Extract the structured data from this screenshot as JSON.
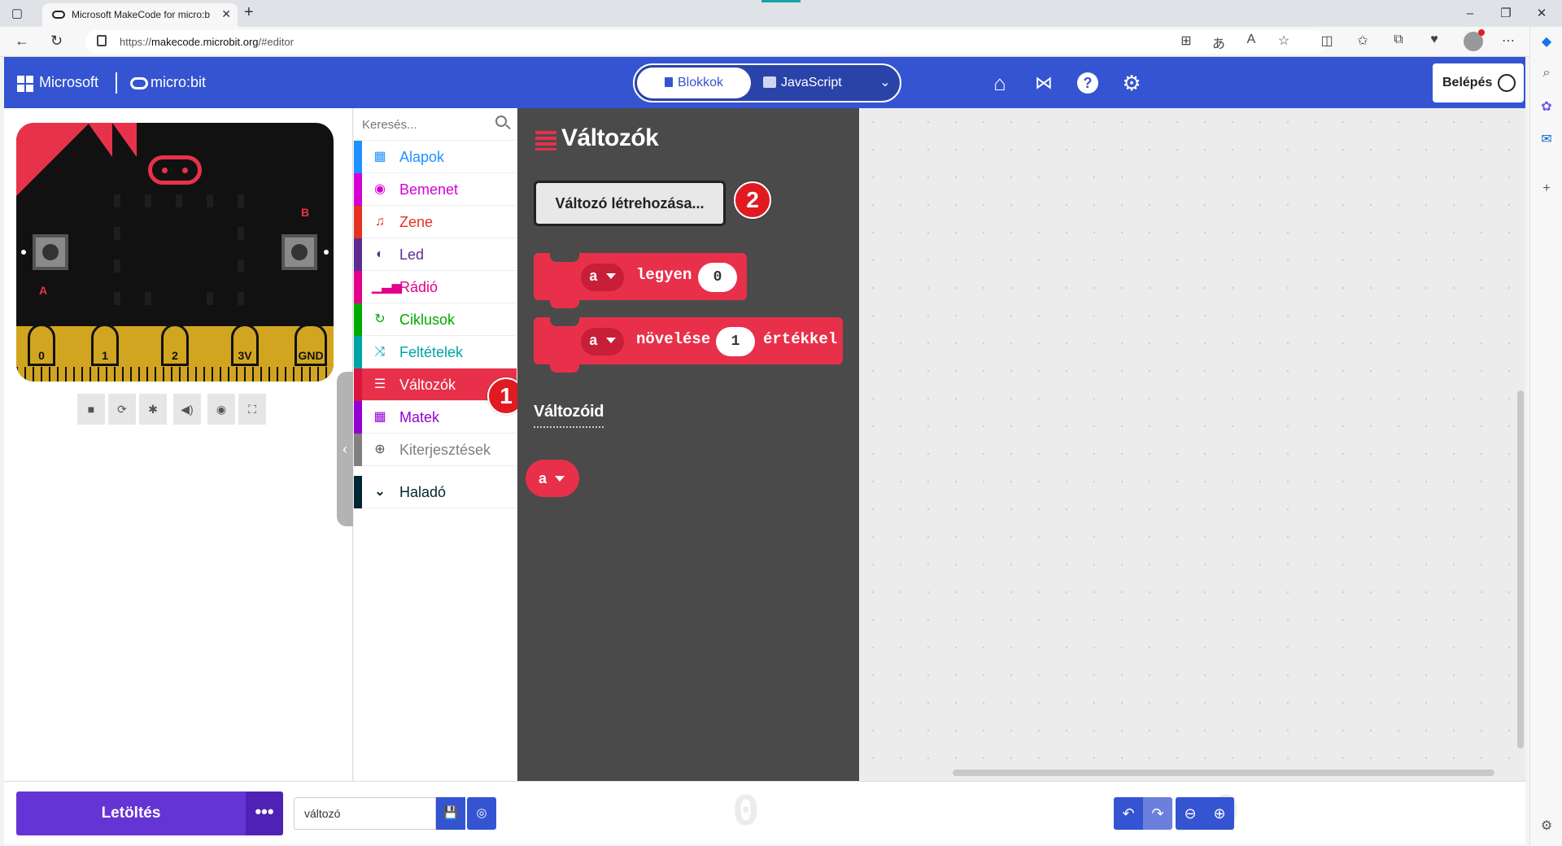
{
  "browser": {
    "tab_title": "Microsoft MakeCode for micro:bit",
    "url_prefix": "https://",
    "url_domain": "makecode.microbit.org",
    "url_path": "/#editor"
  },
  "header": {
    "brand": "Microsoft",
    "product": "micro:bit",
    "mode_blocks": "Blokkok",
    "mode_js": "JavaScript",
    "login_label": "Belépés"
  },
  "toolbox": {
    "search_placeholder": "Keresés...",
    "categories": [
      {
        "label": "Alapok",
        "color": "#1e90ff",
        "icon": "grid-icon"
      },
      {
        "label": "Bemenet",
        "color": "#d400d4",
        "icon": "input-icon"
      },
      {
        "label": "Zene",
        "color": "#e63022",
        "icon": "headphones-icon"
      },
      {
        "label": "Led",
        "color": "#5c2d91",
        "icon": "toggle-icon"
      },
      {
        "label": "Rádió",
        "color": "#e3008c",
        "icon": "signal-icon"
      },
      {
        "label": "Ciklusok",
        "color": "#00aa00",
        "icon": "loop-icon"
      },
      {
        "label": "Feltételek",
        "color": "#00a4a6",
        "icon": "shuffle-icon"
      },
      {
        "label": "Változók",
        "color": "#dc143c",
        "icon": "list-icon"
      },
      {
        "label": "Matek",
        "color": "#9400d3",
        "icon": "calculator-icon"
      },
      {
        "label": "Kiterjesztések",
        "color": "#7f7f7f",
        "icon": "plus-circle-icon"
      }
    ],
    "advanced_label": "Haladó",
    "advanced_color": "#002633",
    "marker_1": "1"
  },
  "flyout": {
    "title": "Változók",
    "make_var_label": "Változó létrehozása...",
    "marker_2": "2",
    "set_block": {
      "var": "a",
      "word": "legyen",
      "value": "0"
    },
    "change_block": {
      "var": "a",
      "word": "növelése",
      "value": "1",
      "suffix": "értékkel"
    },
    "your_vars_heading": "Változóid",
    "var_name": "a"
  },
  "simulator": {
    "pins": [
      "0",
      "1",
      "2",
      "3V",
      "GND"
    ],
    "btn_a": "A",
    "btn_b": "B"
  },
  "footer": {
    "download_label": "Letöltés",
    "more_label": "•••",
    "project_name": "változó"
  },
  "colors": {
    "accent": "#3454d1",
    "variables": "#e8304a",
    "download": "#6434d4"
  }
}
